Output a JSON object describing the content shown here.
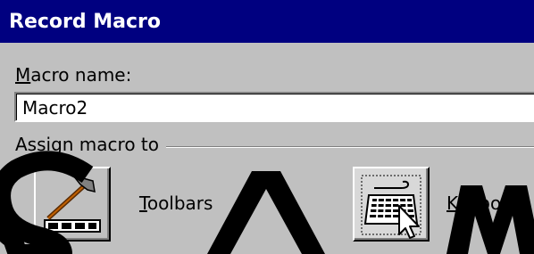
{
  "dialog": {
    "title": "Record Macro",
    "macro_name": {
      "label_u": "M",
      "label_rest": "acro name:",
      "value": "Macro2"
    },
    "assign": {
      "group_label": "Assign macro to",
      "toolbars": {
        "label_u": "T",
        "label_rest": "oolbars",
        "icon": "toolbar-hammer-icon"
      },
      "keyboard": {
        "label_u": "K",
        "label_rest": "eyboard",
        "icon": "keyboard-icon"
      }
    }
  },
  "colors": {
    "titlebar": "#000080",
    "face": "#c0c0c0",
    "watermark": "#000000"
  }
}
